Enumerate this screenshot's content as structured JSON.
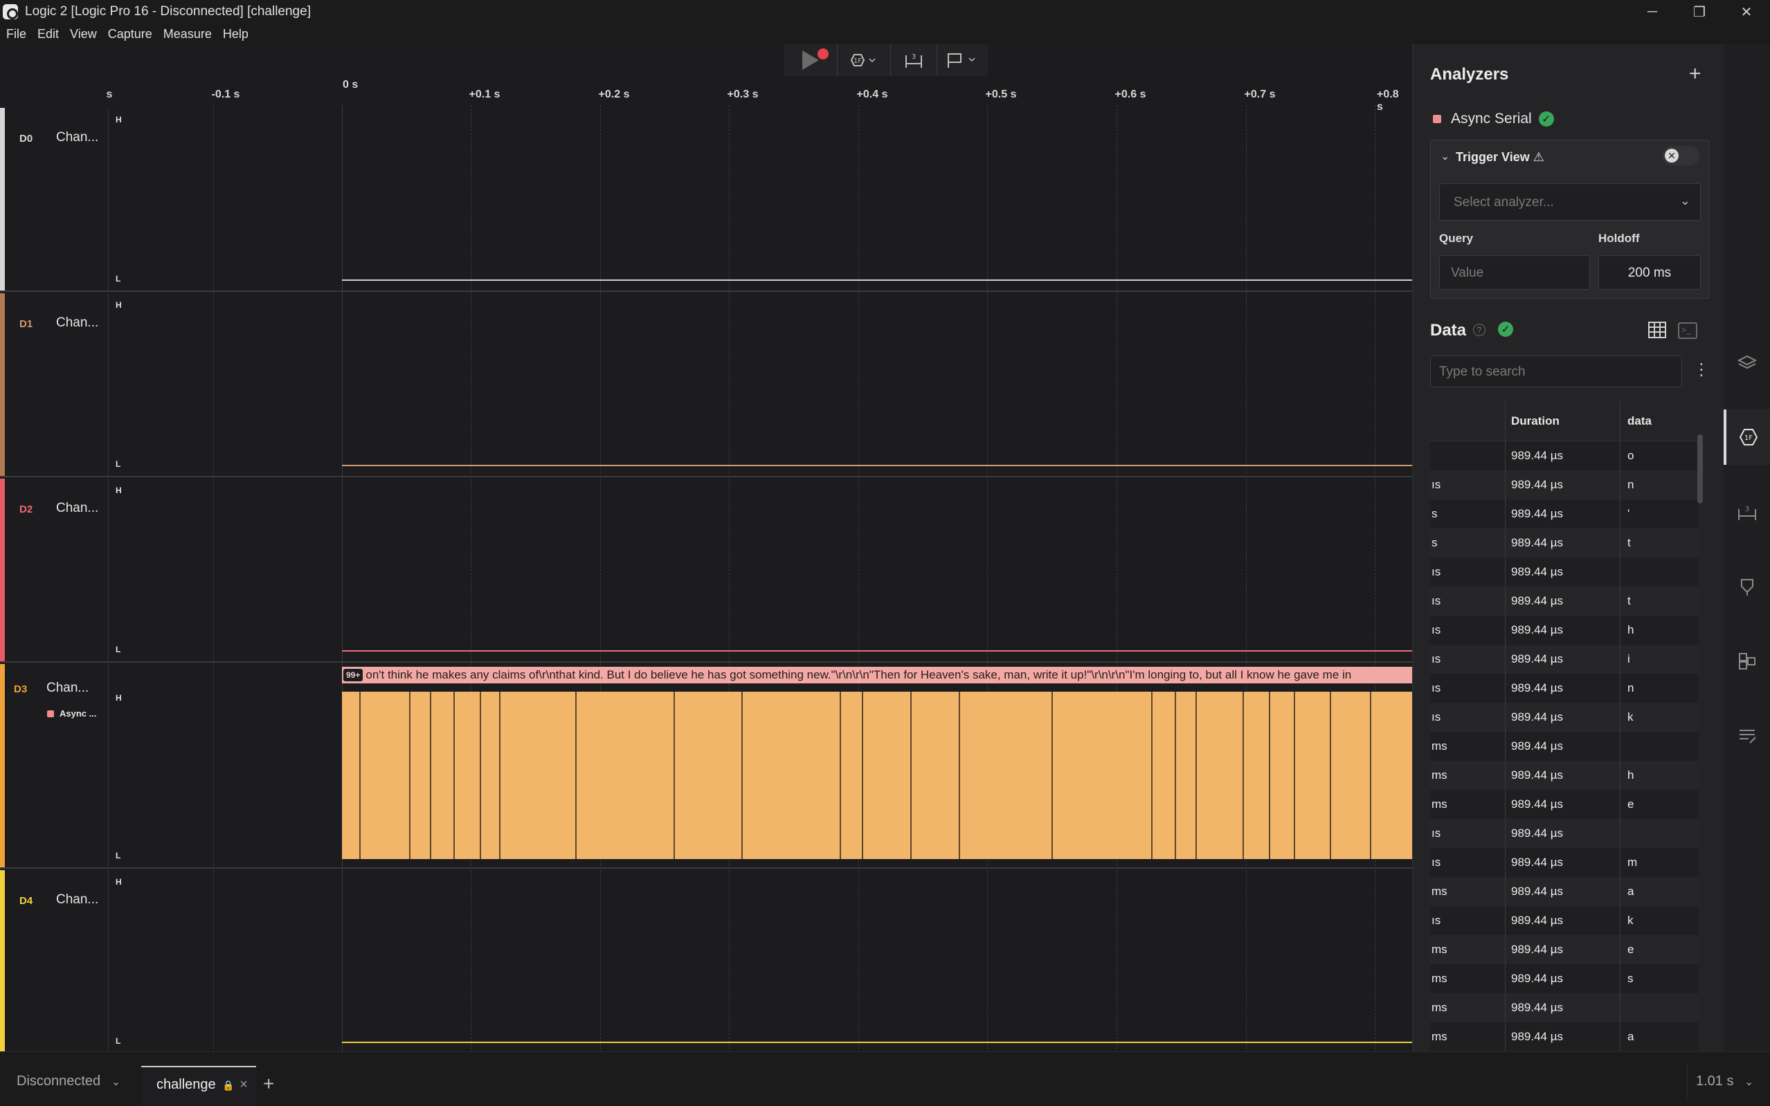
{
  "window": {
    "title": "Logic 2 [Logic Pro 16 - Disconnected] [challenge]",
    "minimize": "─",
    "maximize": "❐",
    "close": "✕"
  },
  "menu": [
    "File",
    "Edit",
    "View",
    "Capture",
    "Measure",
    "Help"
  ],
  "toolbar": {
    "icons": [
      "play-icon",
      "record-dot-icon",
      "analyzer-icon",
      "measurement-icon",
      "marker-icon"
    ]
  },
  "ruler": {
    "ticks": [
      "-0.1 s",
      "+0.1 s",
      "+0.2 s",
      "+0.3 s",
      "+0.4 s",
      "+0.5 s",
      "+0.6 s",
      "+0.7 s",
      "+0.8 s"
    ],
    "zero": "0 s",
    "left_clip": "s"
  },
  "channels": [
    {
      "id": "D0",
      "name": "Chan...",
      "color": "#d6d6d6",
      "low_color": "#cfcfcf"
    },
    {
      "id": "D1",
      "name": "Chan...",
      "color": "#b07a56",
      "low_color": "#d09a72"
    },
    {
      "id": "D2",
      "name": "Chan...",
      "color": "#e85a6a",
      "low_color": "#f06a78"
    },
    {
      "id": "D3",
      "name": "Chan...",
      "color": "#f0a23a",
      "low_color": "#f2b66a",
      "analyzer": "Async ..."
    },
    {
      "id": "D4",
      "name": "Chan...",
      "color": "#f0d23a",
      "low_color": "#f0d23a"
    }
  ],
  "levels": {
    "high": "H",
    "low": "L"
  },
  "decode": {
    "badge": "99+",
    "text": "on't think he makes any claims of\\r\\nthat kind. But I do believe he has got something new.\"\\r\\n\\r\\n\"Then for Heaven's sake, man, write it up!\"\\r\\n\\r\\n\"I'm longing to, but all I know he gave me in"
  },
  "panel": {
    "analyzers_title": "Analyzers",
    "add": "+",
    "analyzer_name": "Async Serial",
    "trigger": {
      "title": "Trigger View ⚠",
      "select_placeholder": "Select analyzer...",
      "query_label": "Query",
      "holdoff_label": "Holdoff",
      "query_placeholder": "Value",
      "holdoff_value": "200 ms"
    },
    "data_title": "Data",
    "search_placeholder": "Type to search",
    "columns": {
      "start": "",
      "duration": "Duration",
      "data": "data"
    },
    "rows": [
      {
        "start": "",
        "duration": "989.44 µs",
        "data": "o"
      },
      {
        "start": "ıs",
        "duration": "989.44 µs",
        "data": "n"
      },
      {
        "start": "s",
        "duration": "989.44 µs",
        "data": "'"
      },
      {
        "start": "s",
        "duration": "989.44 µs",
        "data": "t"
      },
      {
        "start": "ıs",
        "duration": "989.44 µs",
        "data": ""
      },
      {
        "start": "ıs",
        "duration": "989.44 µs",
        "data": "t"
      },
      {
        "start": "ıs",
        "duration": "989.44 µs",
        "data": "h"
      },
      {
        "start": "ıs",
        "duration": "989.44 µs",
        "data": "i"
      },
      {
        "start": "ıs",
        "duration": "989.44 µs",
        "data": "n"
      },
      {
        "start": "ıs",
        "duration": "989.44 µs",
        "data": "k"
      },
      {
        "start": "ms",
        "duration": "989.44 µs",
        "data": ""
      },
      {
        "start": "ms",
        "duration": "989.44 µs",
        "data": "h"
      },
      {
        "start": "ms",
        "duration": "989.44 µs",
        "data": "e"
      },
      {
        "start": "ıs",
        "duration": "989.44 µs",
        "data": ""
      },
      {
        "start": "ıs",
        "duration": "989.44 µs",
        "data": "m"
      },
      {
        "start": "ms",
        "duration": "989.44 µs",
        "data": "a"
      },
      {
        "start": "ıs",
        "duration": "989.44 µs",
        "data": "k"
      },
      {
        "start": "ms",
        "duration": "989.44 µs",
        "data": "e"
      },
      {
        "start": "ms",
        "duration": "989.44 µs",
        "data": "s"
      },
      {
        "start": "ms",
        "duration": "989.44 µs",
        "data": ""
      },
      {
        "start": "ms",
        "duration": "989.44 µs",
        "data": "a"
      }
    ]
  },
  "rail": [
    "layers-icon",
    "analyzer-icon",
    "timing-marker-icon",
    "marker-pin-icon",
    "extensions-icon",
    "notes-icon"
  ],
  "bottom": {
    "device": "Disconnected",
    "session": "challenge",
    "session_close": "×",
    "new_tab": "+",
    "duration": "1.01 s"
  },
  "theme": {
    "accent": "#f2b66a",
    "decode": "#f2a9a4",
    "check": "#3aa65a"
  }
}
